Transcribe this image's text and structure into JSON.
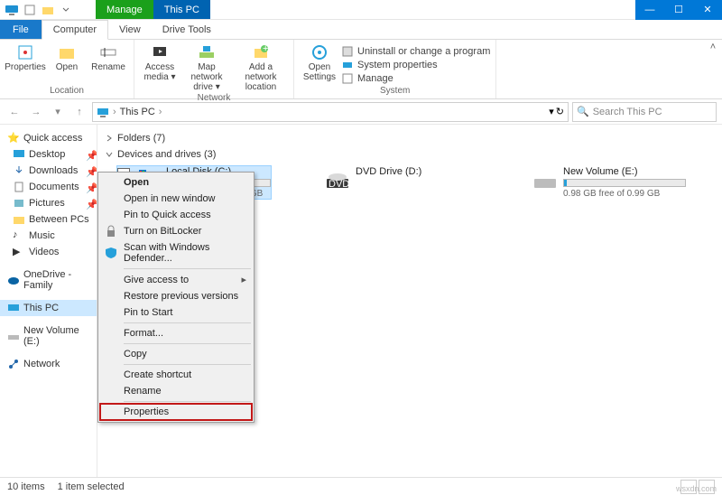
{
  "title_tabs": {
    "manage": "Manage",
    "context": "This PC"
  },
  "menu": {
    "file": "File",
    "computer": "Computer",
    "view": "View",
    "drive_tools": "Drive Tools"
  },
  "ribbon": {
    "location": {
      "properties": "Properties",
      "open": "Open",
      "rename": "Rename",
      "label": "Location"
    },
    "network": {
      "access_media": "Access media ▾",
      "map_drive": "Map network drive ▾",
      "add_location": "Add a network location",
      "label": "Network"
    },
    "system": {
      "open_settings": "Open Settings",
      "uninstall": "Uninstall or change a program",
      "sys_props": "System properties",
      "manage": "Manage",
      "label": "System"
    }
  },
  "nav": {
    "back": "←",
    "forward": "→",
    "up": "↑",
    "crumb_root": "This PC",
    "separator": "›",
    "refresh": "↻",
    "search_placeholder": "Search This PC"
  },
  "sidebar": {
    "quick_access": "Quick access",
    "items": [
      {
        "label": "Desktop"
      },
      {
        "label": "Downloads"
      },
      {
        "label": "Documents"
      },
      {
        "label": "Pictures"
      },
      {
        "label": "Between PCs"
      },
      {
        "label": "Music"
      },
      {
        "label": "Videos"
      }
    ],
    "onedrive": "OneDrive - Family",
    "this_pc": "This PC",
    "new_volume": "New Volume (E:)",
    "network": "Network"
  },
  "sections": {
    "folders": "Folders (7)",
    "drives": "Devices and drives (3)"
  },
  "drives": [
    {
      "name": "Local Disk (C:)",
      "free": "15.4 GB free of 33.6 GB",
      "fill_pct": 54
    },
    {
      "name": "DVD Drive (D:)",
      "free": ""
    },
    {
      "name": "New Volume (E:)",
      "free": "0.98 GB free of 0.99 GB",
      "fill_pct": 2
    }
  ],
  "context_menu": {
    "open": "Open",
    "open_new": "Open in new window",
    "pin_qa": "Pin to Quick access",
    "bitlocker": "Turn on BitLocker",
    "defender": "Scan with Windows Defender...",
    "give_access": "Give access to",
    "restore": "Restore previous versions",
    "pin_start": "Pin to Start",
    "format": "Format...",
    "copy": "Copy",
    "shortcut": "Create shortcut",
    "rename": "Rename",
    "properties": "Properties"
  },
  "status": {
    "count": "10 items",
    "selected": "1 item selected"
  },
  "watermark": "wsxdn.com"
}
